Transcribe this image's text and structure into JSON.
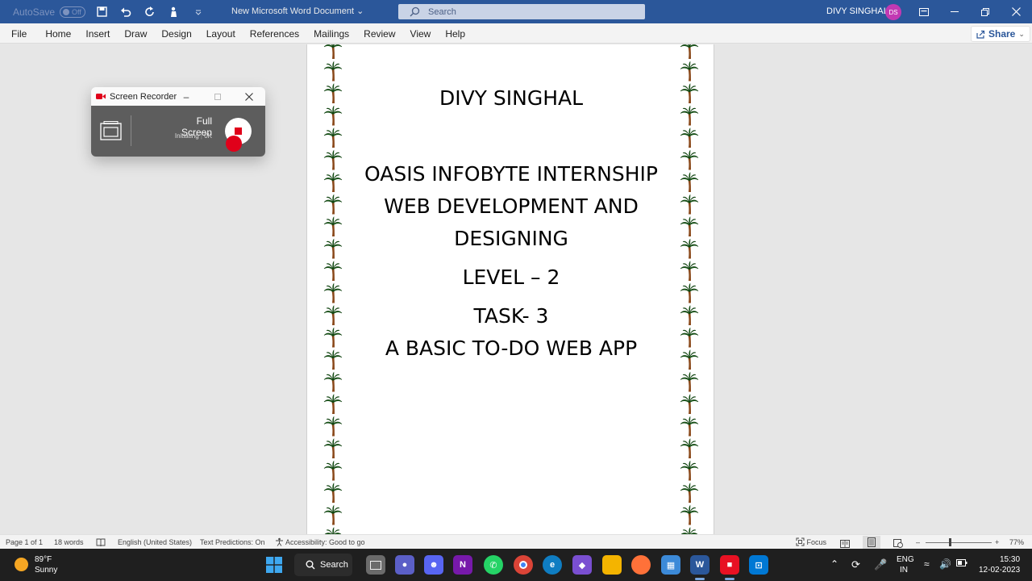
{
  "titlebar": {
    "autosave_label": "AutoSave",
    "autosave_state": "Off",
    "doc_title": "New Microsoft Word Document",
    "search_placeholder": "Search",
    "user_name": "DIVY SINGHAL",
    "user_initials": "DS"
  },
  "ribbon": {
    "tabs": [
      "File",
      "Home",
      "Insert",
      "Draw",
      "Design",
      "Layout",
      "References",
      "Mailings",
      "Review",
      "View",
      "Help"
    ],
    "share_label": "Share"
  },
  "document": {
    "name_line": "DIVY SINGHAL",
    "line1": "OASIS INFOBYTE INTERNSHIP",
    "line2": "WEB DEVELOPMENT AND",
    "line3": "DESIGNING",
    "level": "LEVEL – 2",
    "task": "TASK- 3",
    "project": "A BASIC TO-DO WEB APP"
  },
  "recorder": {
    "title": "Screen Recorder",
    "mode": "Full Screen",
    "status": "Initiating",
    "size": "0K"
  },
  "statusbar": {
    "page": "Page 1 of 1",
    "words": "18 words",
    "language": "English (United States)",
    "predictions": "Text Predictions: On",
    "accessibility": "Accessibility: Good to go",
    "focus": "Focus",
    "zoom": "77%"
  },
  "taskbar": {
    "weather_temp": "89°F",
    "weather_desc": "Sunny",
    "search_label": "Search",
    "lang_top": "ENG",
    "lang_bottom": "IN",
    "time": "15:30",
    "date": "12-02-2023"
  },
  "colors": {
    "word_blue": "#2b579a",
    "record_red": "#e0001a",
    "avatar_pink": "#c239b3"
  }
}
